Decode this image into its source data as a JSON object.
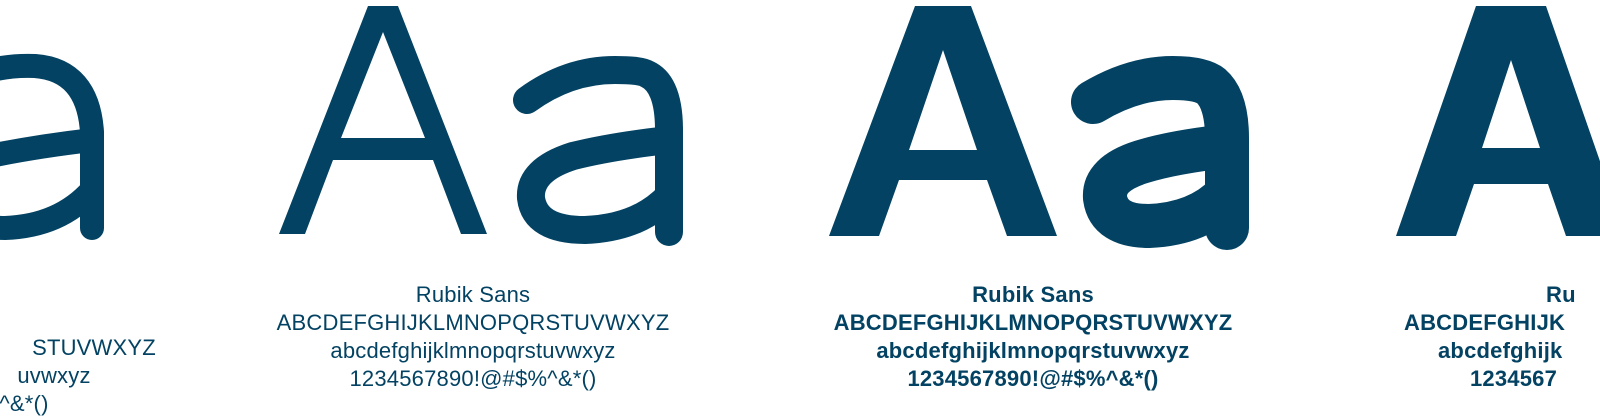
{
  "colors": {
    "ink": "#034262",
    "background": "#ffffff"
  },
  "panels": [
    {
      "weight": "light",
      "glyphs": "Aa",
      "font_name": "",
      "uppercase": "STUVWXYZ",
      "lowercase": "uvwxyz",
      "digits": "^&*()"
    },
    {
      "weight": "regular",
      "glyphs": "Aa",
      "font_name": "Rubik Sans",
      "uppercase": "ABCDEFGHIJKLMNOPQRSTUVWXYZ",
      "lowercase": "abcdefghijklmnopqrstuvwxyz",
      "digits": "1234567890!@#$%^&*()"
    },
    {
      "weight": "medium",
      "glyphs": "Aa",
      "font_name": "Rubik Sans",
      "uppercase": "ABCDEFGHIJKLMNOPQRSTUVWXYZ",
      "lowercase": "abcdefghijklmnopqrstuvwxyz",
      "digits": "1234567890!@#$%^&*()"
    },
    {
      "weight": "bold",
      "glyphs": "A",
      "font_name": "Ru",
      "uppercase": "ABCDEFGHIJK",
      "lowercase": "abcdefghijk",
      "digits": "1234567"
    }
  ]
}
